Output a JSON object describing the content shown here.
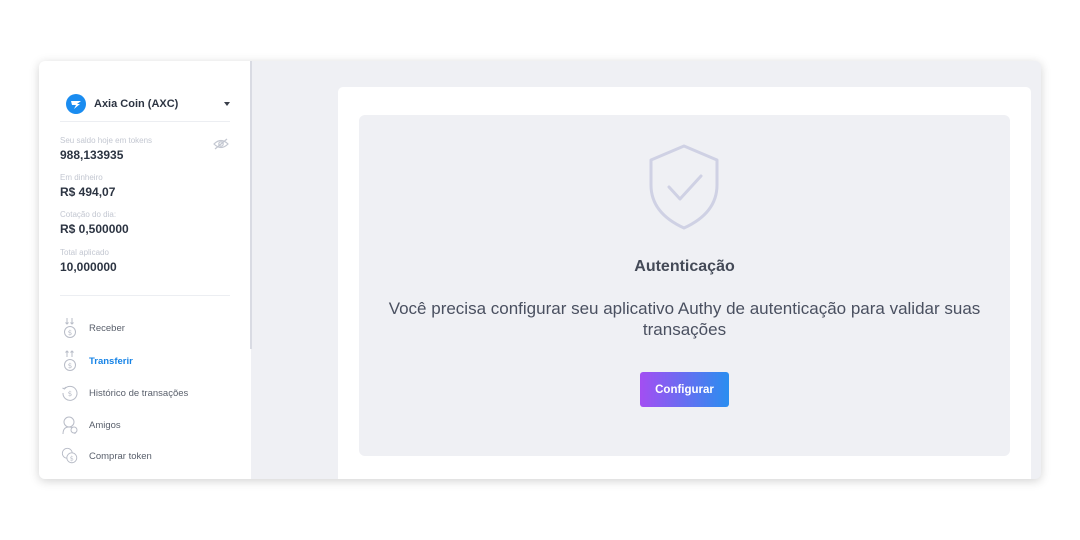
{
  "coin_selector": {
    "name": "Axia Coin (AXC)",
    "icon": "axia-coin-logo-icon",
    "brand_color": "#1a8cf0"
  },
  "balance": {
    "tokens_label": "Seu saldo hoje em tokens",
    "tokens_value": "988,133935",
    "cash_label": "Em dinheiro",
    "cash_value": "R$ 494,07",
    "rate_label": "Cotação do dia:",
    "rate_value": "R$ 0,500000",
    "applied_label": "Total aplicado",
    "applied_value": "10,000000",
    "hide_icon": "eye-off-icon"
  },
  "sidebar": {
    "items": [
      {
        "label": "Receber",
        "icon": "receive-coin-icon",
        "active": false
      },
      {
        "label": "Transferir",
        "icon": "transfer-coin-icon",
        "active": true
      },
      {
        "label": "Histórico de transações",
        "icon": "history-icon",
        "active": false
      },
      {
        "label": "Amigos",
        "icon": "friends-icon",
        "active": false
      },
      {
        "label": "Comprar token",
        "icon": "buy-token-icon",
        "active": false
      }
    ]
  },
  "auth": {
    "icon": "shield-check-icon",
    "title": "Autenticação",
    "message": "Você precisa configurar seu aplicativo Authy de autenticação para validar suas transações",
    "button_label": "Configurar"
  },
  "colors": {
    "accent": "#1683e6",
    "button_gradient_start": "#a34ef2",
    "button_gradient_end": "#2a8ef0"
  }
}
